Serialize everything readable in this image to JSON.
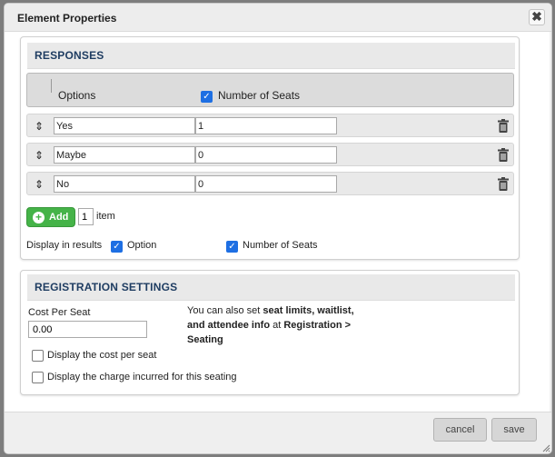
{
  "dialog": {
    "title": "Element Properties",
    "close_glyph": "✖"
  },
  "responses": {
    "title": "RESPONSES",
    "header_options": "Options",
    "header_seats": "Number of Seats",
    "header_seats_checked": true,
    "rows": [
      {
        "option": "Yes",
        "seats": "1"
      },
      {
        "option": "Maybe",
        "seats": "0"
      },
      {
        "option": "No",
        "seats": "0"
      }
    ],
    "add_label": "Add",
    "add_quantity": "1",
    "add_quantity_unit": "item",
    "display_in_results_label": "Display in results",
    "display_option_label": "Option",
    "display_option_checked": true,
    "display_seats_label": "Number of Seats",
    "display_seats_checked": true
  },
  "registration": {
    "title": "REGISTRATION SETTINGS",
    "cost_label": "Cost Per Seat",
    "cost_value": "0.00",
    "info_prefix": "You can also set ",
    "info_bold": "seat limits, waitlist, and attendee info",
    "info_mid": " at ",
    "info_link": "Registration > Seating",
    "display_cost_label": "Display the cost per seat",
    "display_cost_checked": false,
    "display_charge_label": "Display the charge incurred for this seating",
    "display_charge_checked": false
  },
  "footer": {
    "cancel_label": "cancel",
    "save_label": "save"
  },
  "colors": {
    "section_title": "#1f3d62",
    "add_button": "#45b348",
    "checkbox": "#1e6fe3"
  }
}
